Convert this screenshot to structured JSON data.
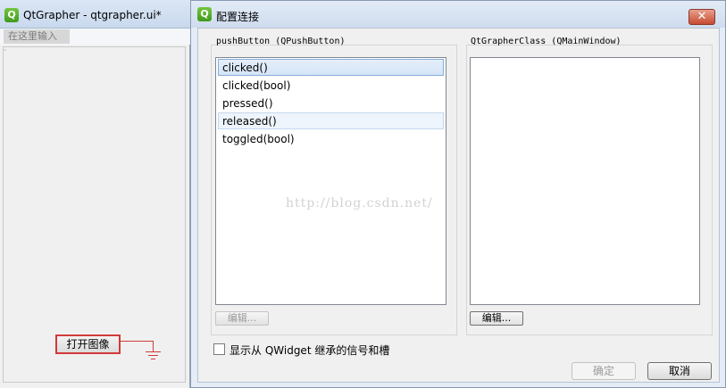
{
  "background_window": {
    "logo": "Q",
    "title": "QtGrapher - qtgrapher.ui*",
    "menu_placeholder": "在这里输入",
    "form_button_label": "打开图像"
  },
  "dialog": {
    "logo": "Q",
    "title": "配置连接",
    "close_glyph": "✕",
    "sender": {
      "title": "pushButton (QPushButton)",
      "signals": [
        "clicked()",
        "clicked(bool)",
        "pressed()",
        "released()",
        "toggled(bool)"
      ],
      "selected_index": 0,
      "hover_index": 3,
      "edit_label": "编辑..."
    },
    "receiver": {
      "title": "QtGrapherClass (QMainWindow)",
      "slots": [],
      "edit_label": "编辑..."
    },
    "inherit_checkbox": {
      "label": "显示从 QWidget 继承的信号和槽",
      "checked": false
    },
    "ok_label": "确定",
    "cancel_label": "取消",
    "watermark": "http://blog.csdn.net/"
  },
  "colors": {
    "qt_green": "#5bb52e",
    "connection_red": "#d23a3a",
    "selection_blue": "#d4e4f7"
  }
}
